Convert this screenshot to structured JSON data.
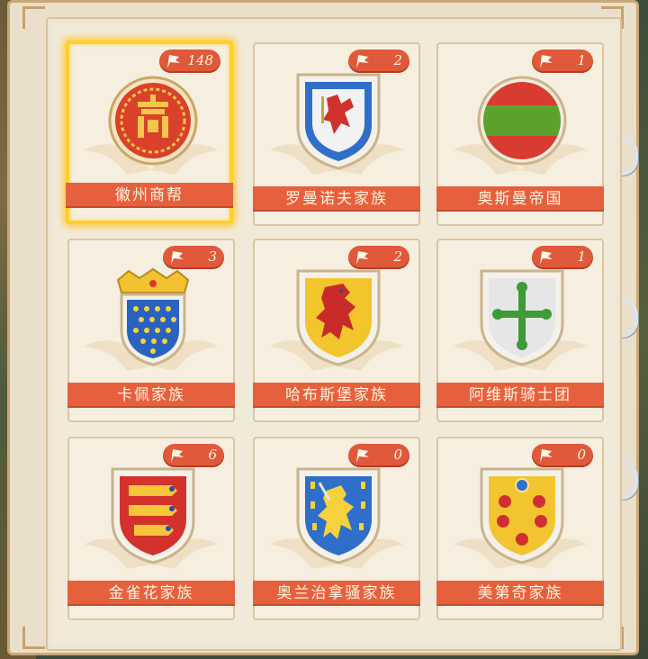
{
  "collection": {
    "cards": [
      {
        "name": "徽州商帮",
        "count": "148",
        "emblem": "huizhou-seal-icon",
        "selected": true
      },
      {
        "name": "罗曼诺夫家族",
        "count": "2",
        "emblem": "griffin-shield-icon",
        "selected": false
      },
      {
        "name": "奥斯曼帝国",
        "count": "1",
        "emblem": "crescents-roundel-icon",
        "selected": false
      },
      {
        "name": "卡佩家族",
        "count": "3",
        "emblem": "fleur-de-lis-crown-shield-icon",
        "selected": false
      },
      {
        "name": "哈布斯堡家族",
        "count": "2",
        "emblem": "red-lion-shield-icon",
        "selected": false
      },
      {
        "name": "阿维斯骑士团",
        "count": "1",
        "emblem": "green-cross-shield-icon",
        "selected": false
      },
      {
        "name": "金雀花家族",
        "count": "6",
        "emblem": "three-lions-shield-icon",
        "selected": false
      },
      {
        "name": "奥兰治拿骚家族",
        "count": "0",
        "emblem": "gold-lion-billets-shield-icon",
        "selected": false
      },
      {
        "name": "美第奇家族",
        "count": "0",
        "emblem": "medici-balls-shield-icon",
        "selected": false
      }
    ]
  },
  "colors": {
    "label_bg": "#e7603e",
    "badge_bg": "#e0593a",
    "selected_border": "#ffcf2a",
    "page_bg": "#f2ead9"
  }
}
